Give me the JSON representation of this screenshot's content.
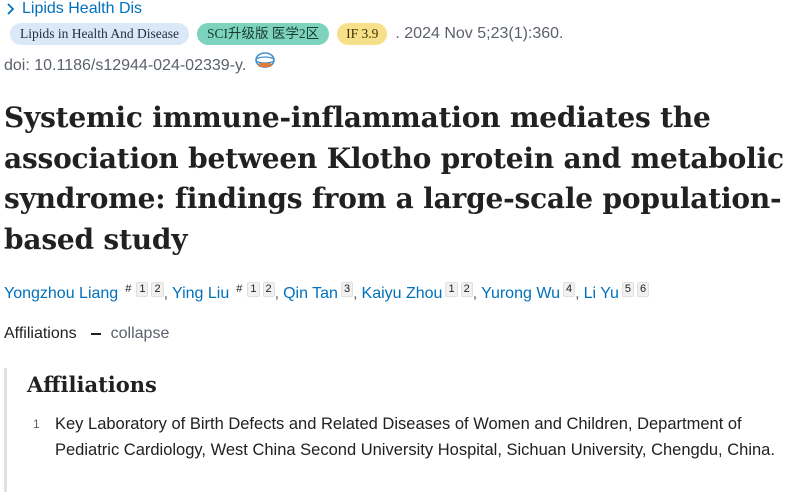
{
  "journal": {
    "name": "Lipids Health Dis"
  },
  "badges": {
    "journal_full": "Lipids in Health And Disease",
    "sci": "SCI升级版 医学2区",
    "impact_factor": "IF 3.9"
  },
  "citation": ". 2024 Nov 5;23(1):360.",
  "doi": "doi: 10.1186/s12944-024-02339-y.",
  "title": "Systemic immune-inflammation mediates the association between Klotho protein and metabolic syndrome: findings from a large-scale population-based study",
  "authors": [
    {
      "name": "Yongzhou Liang",
      "equal": "#",
      "affs": [
        "1",
        "2"
      ]
    },
    {
      "name": "Ying Liu",
      "equal": "#",
      "affs": [
        "1",
        "2"
      ]
    },
    {
      "name": "Qin Tan",
      "equal": "",
      "affs": [
        "3"
      ]
    },
    {
      "name": "Kaiyu Zhou",
      "equal": "",
      "affs": [
        "1",
        "2"
      ]
    },
    {
      "name": "Yurong Wu",
      "equal": "",
      "affs": [
        "4"
      ]
    },
    {
      "name": "Li Yu",
      "equal": "",
      "affs": [
        "5",
        "6"
      ]
    }
  ],
  "affiliations_toggle": {
    "label": "Affiliations",
    "collapse_label": "collapse"
  },
  "affiliations": {
    "heading": "Affiliations",
    "items": [
      {
        "number": "1",
        "text": "Key Laboratory of Birth Defects and Related Diseases of Women and Children, Department of Pediatric Cardiology, West China Second University Hospital, Sichuan University, Chengdu, China."
      }
    ]
  },
  "colors": {
    "link": "#0071bc",
    "badge_journal": "#dbe8f7",
    "badge_sci": "#7ed3bf",
    "badge_if": "#f7e08a"
  },
  "icons": {
    "journal_chevron": "chevron-right-icon",
    "doi_logo": "full-text-link-icon"
  }
}
